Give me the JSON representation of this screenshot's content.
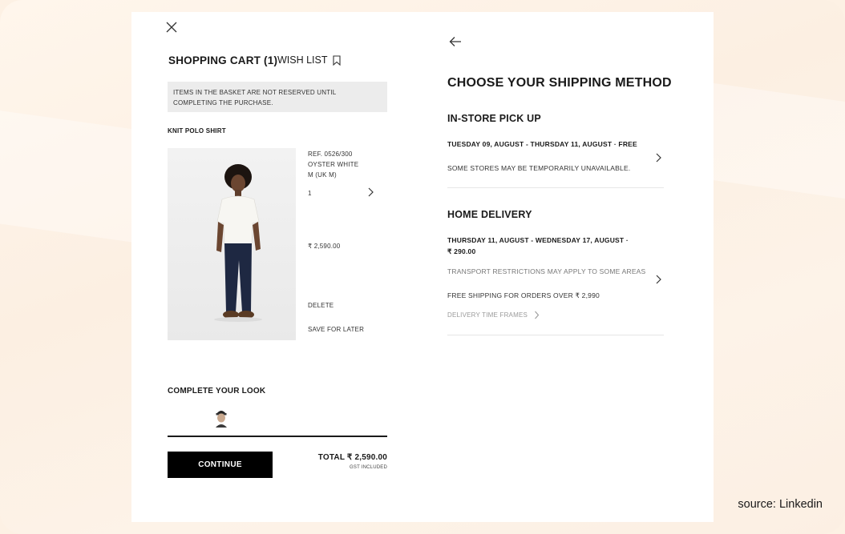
{
  "cart": {
    "title": "SHOPPING CART (1)",
    "wish_list": "WISH LIST",
    "notice": "ITEMS IN THE BASKET ARE NOT RESERVED UNTIL COMPLETING THE PURCHASE.",
    "item": {
      "name": "KNIT POLO SHIRT",
      "ref": "REF. 0526/300",
      "color": "OYSTER WHITE",
      "size": "M (UK M)",
      "quantity": "1",
      "price": "₹ 2,590.00",
      "delete_label": "DELETE",
      "save_later_label": "SAVE FOR LATER"
    },
    "complete_look": "COMPLETE YOUR LOOK",
    "continue_label": "CONTINUE",
    "total": "TOTAL ₹ 2,590.00",
    "gst": "GST INCLUDED"
  },
  "shipping": {
    "title": "CHOOSE YOUR SHIPPING METHOD",
    "pickup": {
      "title": "IN-STORE PICK UP",
      "dates": "TUESDAY 09, AUGUST - THURSDAY 11, AUGUST · FREE",
      "note": "SOME STORES MAY BE TEMPORARILY UNAVAILABLE."
    },
    "home": {
      "title": "HOME DELIVERY",
      "dates_line1": "THURSDAY 11, AUGUST - WEDNESDAY 17, AUGUST ·",
      "dates_line2": "₹ 290.00",
      "restriction": "TRANSPORT RESTRICTIONS MAY APPLY TO SOME AREAS",
      "free_shipping": "FREE SHIPPING FOR ORDERS OVER ₹ 2,990",
      "time_frames": "DELIVERY TIME FRAMES"
    }
  },
  "source": "source: Linkedin",
  "colors": {
    "background": "#fdf1e4",
    "card": "#ffffff",
    "notice_bg": "#ececec",
    "button": "#000000"
  }
}
